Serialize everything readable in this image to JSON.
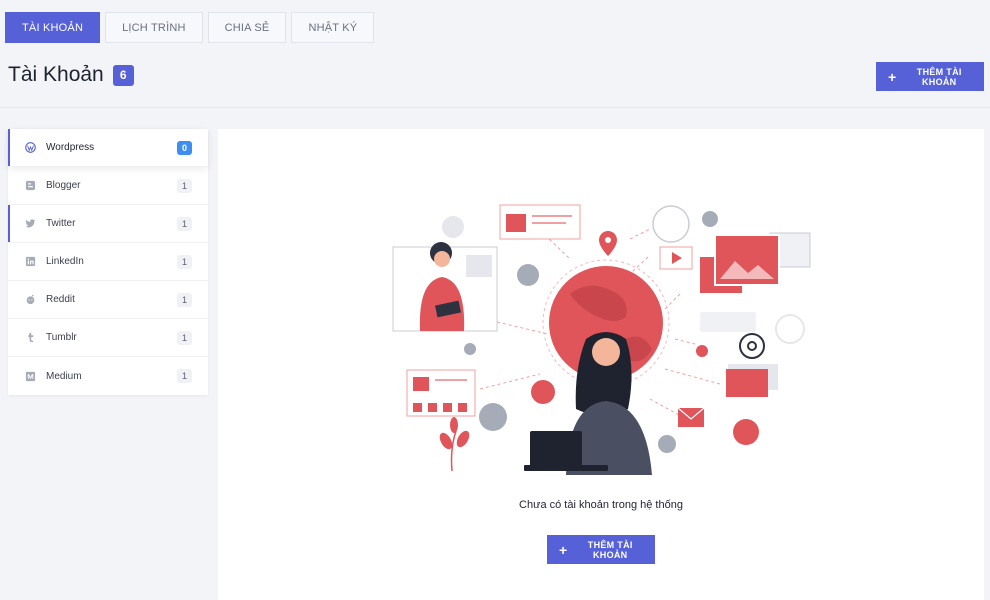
{
  "tabs": [
    {
      "label": "TÀI KHOẢN",
      "active": true
    },
    {
      "label": "LỊCH TRÌNH",
      "active": false
    },
    {
      "label": "CHIA SẺ",
      "active": false
    },
    {
      "label": "NHẬT KÝ",
      "active": false
    }
  ],
  "header": {
    "title": "Tài Khoản",
    "count": "6",
    "add_button": "THÊM TÀI KHOẢN",
    "add_icon": "+"
  },
  "sidebar": {
    "items": [
      {
        "label": "Wordpress",
        "count": "0",
        "icon": "wordpress-icon"
      },
      {
        "label": "Blogger",
        "count": "1",
        "icon": "blogger-icon"
      },
      {
        "label": "Twitter",
        "count": "1",
        "icon": "twitter-icon"
      },
      {
        "label": "LinkedIn",
        "count": "1",
        "icon": "linkedin-icon"
      },
      {
        "label": "Reddit",
        "count": "1",
        "icon": "reddit-icon"
      },
      {
        "label": "Tumblr",
        "count": "1",
        "icon": "tumblr-icon"
      },
      {
        "label": "Medium",
        "count": "1",
        "icon": "medium-icon"
      }
    ]
  },
  "empty_state": {
    "message": "Chưa có tài khoản trong hệ thống",
    "add_button": "THÊM TÀI KHOẢN",
    "add_icon": "+",
    "illustration": "social-media-illustration"
  },
  "colors": {
    "primary": "#5661d8",
    "badge_blue": "#3d8ef0",
    "illustration_red": "#e0555a"
  }
}
